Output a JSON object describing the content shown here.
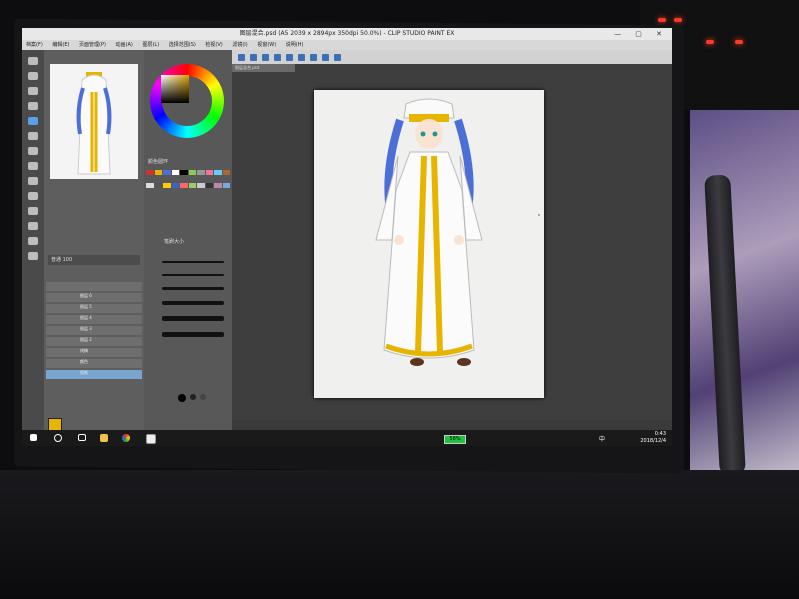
{
  "window": {
    "title": "图层混合.psd (A5 2039 x 2894px 350dpi 50.0%) - CLIP STUDIO PAINT EX",
    "tab": "图层混合.psd"
  },
  "menu": [
    "档案(F)",
    "编辑(E)",
    "页面管理(P)",
    "动画(A)",
    "图层(L)",
    "选择范围(S)",
    "检视(V)",
    "滤镜(I)",
    "视窗(W)",
    "说明(H)"
  ],
  "panels": {
    "color": "颜色圆环",
    "brush": "笔刷大小",
    "layer_mode": "普通",
    "layer_opacity": "100"
  },
  "layers": [
    "图层 6",
    "图层 5",
    "图层 4",
    "图层 3",
    "图层 2",
    "线稿",
    "颜色",
    "用纸"
  ],
  "taskbar": {
    "battery": "58%",
    "lang": "中",
    "time": "0:43",
    "date": "2018/12/4"
  },
  "colors": {
    "accent": "#e7b400",
    "selection": "#5aa0e8"
  },
  "icons": [
    "windows-start-icon",
    "search-icon",
    "task-view-icon",
    "explorer-icon",
    "chrome-icon",
    "clip-studio-icon"
  ]
}
